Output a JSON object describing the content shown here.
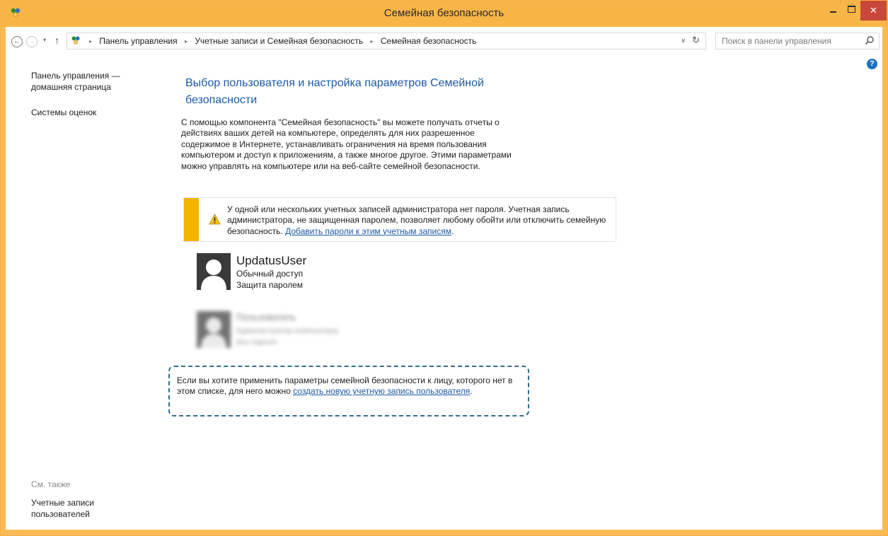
{
  "window": {
    "title": "Семейная безопасность",
    "close_glyph": "✕",
    "accent_color": "#f7b548"
  },
  "nav": {
    "back_glyph": "←",
    "forward_glyph": "→",
    "recent_glyph": "▾",
    "up_glyph": "↑",
    "breadcrumb": [
      "Панель управления",
      "Учетные записи и Семейная безопасность",
      "Семейная безопасность"
    ],
    "crumb_separator": "▸",
    "dropdown_glyph": "∨",
    "refresh_glyph": "↻",
    "search_placeholder": "Поиск в панели управления"
  },
  "sidebar": {
    "home_link": "Панель управления — домашняя страница",
    "ratings_link": "Системы оценок",
    "see_also_label": "См. также",
    "accounts_link": "Учетные записи пользователей"
  },
  "help_glyph": "?",
  "main": {
    "title": "Выбор пользователя и настройка параметров Семейной безопасности",
    "description": "С помощью компонента \"Семейная безопасность\" вы можете получать отчеты о действиях ваших детей на компьютере, определять для них разрешенное содержимое в Интернете, устанавливать ограничения на время пользования компьютером и доступ к приложениям, а также многое другое. Этими параметрами можно управлять на компьютере или на веб-сайте семейной безопасности."
  },
  "warning": {
    "text": "У одной или нескольких учетных записей администратора нет пароля. Учетная запись администратора, не защищенная паролем, позволяет любому обойти или отключить семейную безопасность.",
    "link": "Добавить пароли к этим учетным записям",
    "trailing": "."
  },
  "users": [
    {
      "name": "UpdatusUser",
      "access": "Обычный доступ",
      "password": "Защита паролем"
    },
    {
      "name": "Пользователь",
      "access": "Администратор компьютера",
      "password": "Без пароля"
    }
  ],
  "hint": {
    "text": "Если вы хотите применить параметры семейной безопасности к лицу, которого нет в этом списке, для него можно",
    "link": "создать новую учетную запись пользователя",
    "trailing": "."
  }
}
